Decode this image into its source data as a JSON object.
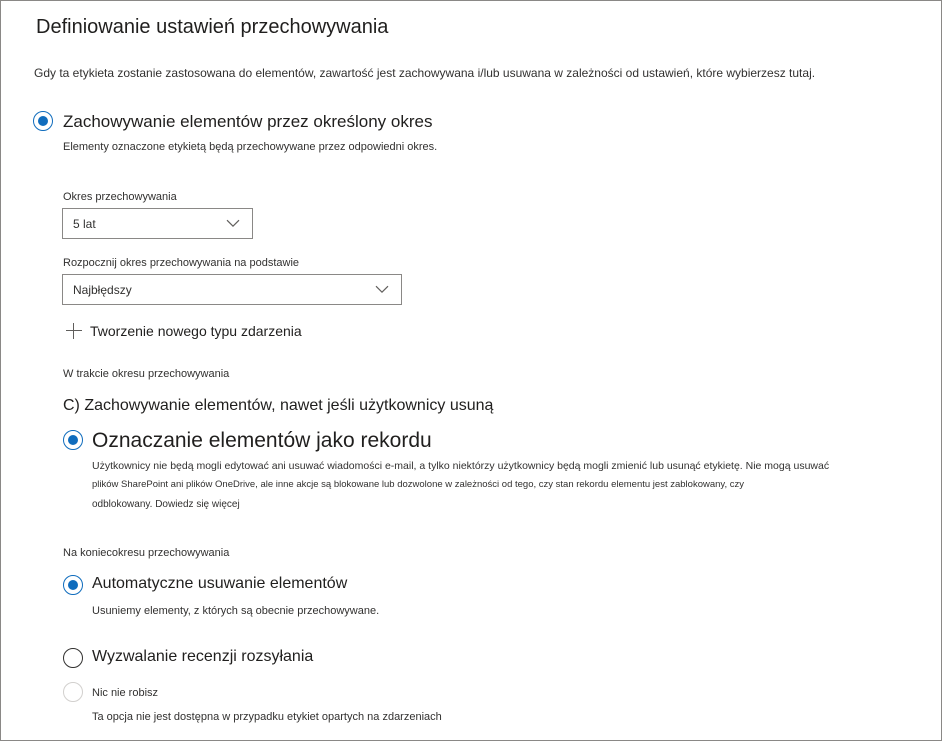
{
  "page": {
    "title": "Definiowanie ustawień przechowywania",
    "intro": "Gdy ta etykieta zostanie zastosowana do elementów, zawartość jest zachowywana i/lub usuwana w zależności od ustawień, które wybierzesz tutaj."
  },
  "retain_option": {
    "label": "Zachowywanie elementów przez określony okres",
    "description": "Elementy oznaczone etykietą będą przechowywane przez odpowiedni okres.",
    "selected": true
  },
  "retention_period": {
    "label": "Okres przechowywania",
    "value": "5 lat"
  },
  "start_based_on": {
    "label": "Rozpocznij okres przechowywania na podstawie",
    "value": "Najbłędszy"
  },
  "create_event_type": {
    "label": "Tworzenie nowego typu zdarzenia"
  },
  "during_period": {
    "label": "W trakcie okresu przechowywania",
    "keep_if_deleted": "C) Zachowywanie elementów, nawet jeśli użytkownicy usuną"
  },
  "record_option": {
    "label": "Oznaczanie elementów jako rekordu",
    "description_line1": "Użytkownicy nie będą mogli edytować ani usuwać wiadomości e-mail, a tylko niektórzy użytkownicy będą mogli zmienić lub usunąć etykietę. Nie mogą usuwać",
    "description_line2": "plików SharePoint ani plików OneDrive, ale inne akcje są blokowane lub dozwolone w zależności od tego, czy stan rekordu elementu jest zablokowany, czy",
    "description_line3": "odblokowany. Dowiedz się więcej",
    "selected": true
  },
  "end_of_period": {
    "label": "Na koniecokresu przechowywania"
  },
  "auto_delete_option": {
    "label": "Automatyczne usuwanie elementów",
    "description": "Usuniemy elementy, z których są obecnie przechowywane.",
    "selected": true
  },
  "disposition_review_option": {
    "label": "Wyzwalanie recenzji rozsyłania",
    "selected": false
  },
  "do_nothing_option": {
    "label": "Nic nie robisz",
    "description": "Ta opcja nie jest dostępna w przypadku etykiet opartych na zdarzeniach",
    "disabled": true
  },
  "colors": {
    "accent": "#0f6cbd",
    "text": "#201f1e",
    "border": "#8a8886"
  }
}
